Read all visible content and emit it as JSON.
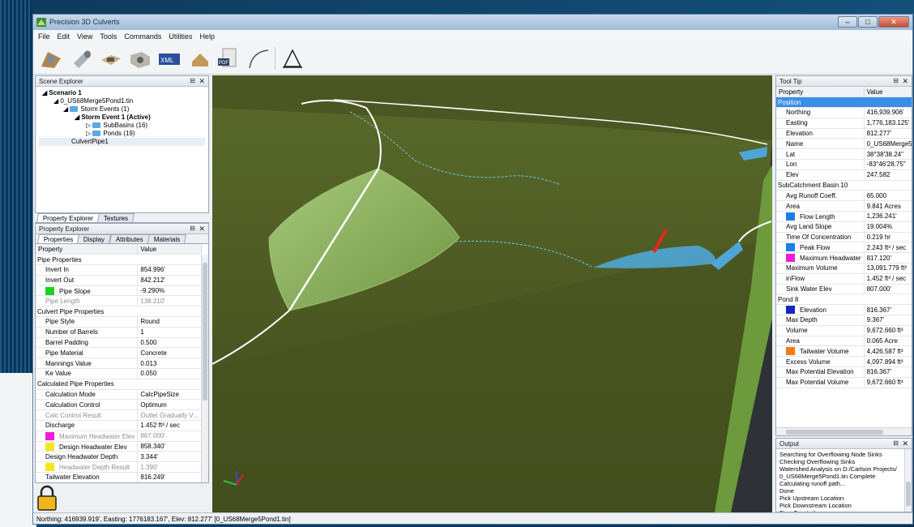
{
  "window": {
    "title": "Precision 3D Culverts",
    "controls": {
      "minimize": "–",
      "maximize": "□",
      "close": "✕"
    }
  },
  "menu": [
    "File",
    "Edit",
    "View",
    "Tools",
    "Commands",
    "Utilities",
    "Help"
  ],
  "toolbar": [
    "culvert-tool-icon",
    "pipe-icon",
    "box-culvert-icon",
    "headwall-icon",
    "landxml-icon",
    "import-icon",
    "pdf-export-icon",
    "curve-icon",
    "survey-icon"
  ],
  "scene_explorer": {
    "title": "Scene Explorer",
    "items": [
      {
        "label": "Scenario 1",
        "bold": true
      },
      {
        "label": "0_US68Merge5Pond1.tin"
      },
      {
        "label": "Storm Events (1)"
      },
      {
        "label": "Storm Event 1 (Active)",
        "bold": true
      },
      {
        "label": "SubBasins (16)"
      },
      {
        "label": "Ponds (19)"
      },
      {
        "label": "CulvertPipe1"
      }
    ],
    "tabs": [
      "Property Explorer",
      "Textures"
    ]
  },
  "property_explorer": {
    "title": "Property Explorer",
    "tabs": [
      "Properties",
      "Display",
      "Attributes",
      "Materials"
    ],
    "columns": [
      "Property",
      "Value"
    ],
    "rows": [
      {
        "type": "cat",
        "name": "Pipe Properties"
      },
      {
        "name": "Invert In",
        "value": "854.996'"
      },
      {
        "name": "Invert Out",
        "value": "842.212'"
      },
      {
        "name": "Pipe Slope",
        "value": "-9.290%",
        "swatch": "#1fd11a"
      },
      {
        "name": "Pipe Length",
        "value": "138.210'",
        "dim": true
      },
      {
        "type": "cat",
        "name": "Culvert Pipe Properties"
      },
      {
        "name": "Pipe Style",
        "value": "Round"
      },
      {
        "name": "Number of Barrels",
        "value": "1"
      },
      {
        "name": "Barrel Padding",
        "value": "0.500"
      },
      {
        "name": "Pipe Material",
        "value": "Concrete"
      },
      {
        "name": "Mannings Value",
        "value": "0.013"
      },
      {
        "name": "Ke Value",
        "value": "0.050"
      },
      {
        "type": "cat",
        "name": "Calculated Pipe Properties"
      },
      {
        "name": "Calculation Mode",
        "value": "CalcPipeSize"
      },
      {
        "name": "Calculation Control",
        "value": "Optimum"
      },
      {
        "name": "Calc Control Result",
        "value": "Outlet Gradually V...",
        "dim": true
      },
      {
        "name": "Discharge",
        "value": "1.452 ft³ / sec"
      },
      {
        "name": "Maximum Headwater Elev",
        "value": "867.000'",
        "swatch": "#f01ad8",
        "dim": true
      },
      {
        "name": "Design Headwater Elev",
        "value": "858.340'",
        "swatch": "#f5e71a"
      },
      {
        "name": "Design Headwater Depth",
        "value": "3.344'"
      },
      {
        "name": "Headwater Depth Result",
        "value": "1.390'",
        "swatch": "#f5e71a",
        "dim": true
      },
      {
        "name": "Tailwater Elevation",
        "value": "816.249'"
      }
    ]
  },
  "tool_tip": {
    "title": "Tool Tip",
    "columns": [
      "Property",
      "Value"
    ],
    "rows": [
      {
        "type": "cat-sel",
        "name": "Position"
      },
      {
        "name": "Northing",
        "value": "416,939.906'"
      },
      {
        "name": "Easting",
        "value": "1,776,183.125'"
      },
      {
        "name": "Elevation",
        "value": "812.277'"
      },
      {
        "name": "Name",
        "value": "0_US68Merge5P..."
      },
      {
        "name": "Lat",
        "value": "38°38'38.24\""
      },
      {
        "name": "Lon",
        "value": "-83°46'28.75\""
      },
      {
        "name": "Elev",
        "value": "247.582"
      },
      {
        "type": "cat",
        "name": "SubCatchment Basin 10"
      },
      {
        "name": "Avg Runoff Coeff.",
        "value": "65.000"
      },
      {
        "name": "Area",
        "value": "9.841 Acres"
      },
      {
        "name": "Flow Length",
        "value": "1,236.241'",
        "swatch": "#1a7fe8"
      },
      {
        "name": "Avg Land Slope",
        "value": "19.004%"
      },
      {
        "name": "Time Of Concentration",
        "value": "0.219 hr"
      },
      {
        "name": "Peak Flow",
        "value": "2.243 ft³ / sec",
        "swatch": "#1a7fe8"
      },
      {
        "name": "Maximum Headwater",
        "value": "817.120'",
        "swatch": "#f01ad8"
      },
      {
        "name": "Maximum Volume",
        "value": "13,091.779 ft³"
      },
      {
        "name": "inFlow",
        "value": "1.452 ft³ / sec"
      },
      {
        "name": "Sink Water Elev",
        "value": "807.000'"
      },
      {
        "type": "cat",
        "name": "Pond 8"
      },
      {
        "name": "Elevation",
        "value": "816.367'",
        "swatch": "#1426c8"
      },
      {
        "name": "Max Depth",
        "value": "9.367'"
      },
      {
        "name": "Volume",
        "value": "9,672.660 ft³"
      },
      {
        "name": "Area",
        "value": "0.065 Acre"
      },
      {
        "name": "Tailwater Volume",
        "value": "4,426.587 ft³",
        "swatch": "#f07a1a"
      },
      {
        "name": "Excess Volume",
        "value": "4,097.894 ft³"
      },
      {
        "name": "Max Potential Elevation",
        "value": "816.367'"
      },
      {
        "name": "Max Potential Volume",
        "value": "9,672.660 ft³"
      }
    ]
  },
  "output": {
    "title": "Output",
    "lines": [
      "Searching for Overflowing Node Sinks",
      "Checking Overflowing Sinks",
      "Watershed Analysis on D:/Carlson Projects/",
      "0_US68Merge5Pond1.tin Complete",
      "Calculating runoff path...",
      "Done",
      "Pick Upstream Location",
      "Pick Downstream Location",
      "Pipe Created"
    ]
  },
  "status_bar": "Northing: 416939.919', Easting: 1776183.167', Elev: 812.277' [0_US68Merge5Pond1.tin]",
  "colors": {
    "accent": "#3b8ee6",
    "terrain": "#4f5b25",
    "water": "#4fa6d6"
  }
}
